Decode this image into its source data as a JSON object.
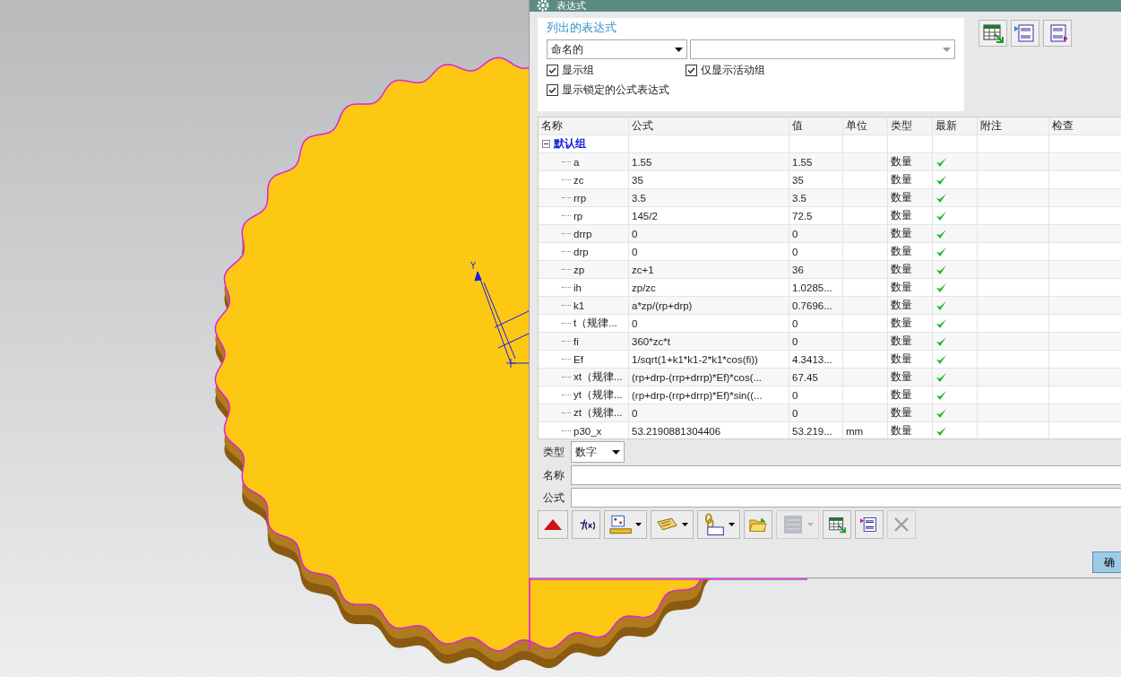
{
  "window": {
    "title": "表达式"
  },
  "listed": {
    "heading": "列出的表达式",
    "filter": "命名的",
    "options": [
      {
        "label": "显示组",
        "checked": true
      },
      {
        "label": "仅显示活动组",
        "checked": true
      },
      {
        "label": "显示锁定的公式表达式",
        "checked": true
      }
    ]
  },
  "table": {
    "columns": [
      "名称",
      "公式",
      "值",
      "单位",
      "类型",
      "最新",
      "附注",
      "检查"
    ],
    "group": {
      "name": "默认组",
      "expanded": true
    },
    "rows": [
      {
        "name": "a",
        "formula": "1.55",
        "value": "1.55",
        "unit": "",
        "type": "数量",
        "up_to_date": true
      },
      {
        "name": "zc",
        "formula": "35",
        "value": "35",
        "unit": "",
        "type": "数量",
        "up_to_date": true
      },
      {
        "name": "rrp",
        "formula": "3.5",
        "value": "3.5",
        "unit": "",
        "type": "数量",
        "up_to_date": true
      },
      {
        "name": "rp",
        "formula": "145/2",
        "value": "72.5",
        "unit": "",
        "type": "数量",
        "up_to_date": true
      },
      {
        "name": "drrp",
        "formula": "0",
        "value": "0",
        "unit": "",
        "type": "数量",
        "up_to_date": true
      },
      {
        "name": "drp",
        "formula": "0",
        "value": "0",
        "unit": "",
        "type": "数量",
        "up_to_date": true
      },
      {
        "name": "zp",
        "formula": "zc+1",
        "value": "36",
        "unit": "",
        "type": "数量",
        "up_to_date": true
      },
      {
        "name": "ih",
        "formula": "zp/zc",
        "value": "1.0285...",
        "unit": "",
        "type": "数量",
        "up_to_date": true
      },
      {
        "name": "k1",
        "formula": "a*zp/(rp+drp)",
        "value": "0.7696...",
        "unit": "",
        "type": "数量",
        "up_to_date": true
      },
      {
        "name": "t（规律...",
        "formula": "0",
        "value": "0",
        "unit": "",
        "type": "数量",
        "up_to_date": true
      },
      {
        "name": "fi",
        "formula": "360*zc*t",
        "value": "0",
        "unit": "",
        "type": "数量",
        "up_to_date": true
      },
      {
        "name": "Ef",
        "formula": "1/sqrt(1+k1*k1-2*k1*cos(fi))",
        "value": "4.3413...",
        "unit": "",
        "type": "数量",
        "up_to_date": true
      },
      {
        "name": "xt（规律...",
        "formula": "(rp+drp-(rrp+drrp)*Ef)*cos(...",
        "value": "67.45",
        "unit": "",
        "type": "数量",
        "up_to_date": true
      },
      {
        "name": "yt（规律...",
        "formula": "(rp+drp-(rrp+drrp)*Ef)*sin((...",
        "value": "0",
        "unit": "",
        "type": "数量",
        "up_to_date": true
      },
      {
        "name": "zt（规律...",
        "formula": "0",
        "value": "0",
        "unit": "",
        "type": "数量",
        "up_to_date": true
      },
      {
        "name": "p30_x",
        "formula": "53.2190881304406",
        "value": "53.219...",
        "unit": "mm",
        "type": "数量",
        "up_to_date": true
      }
    ]
  },
  "editor": {
    "type_label": "类型",
    "type_value": "数字",
    "name_label": "名称",
    "formula_label": "公式"
  },
  "ok_button": "确",
  "viewport": {
    "axis_label": "Y"
  }
}
